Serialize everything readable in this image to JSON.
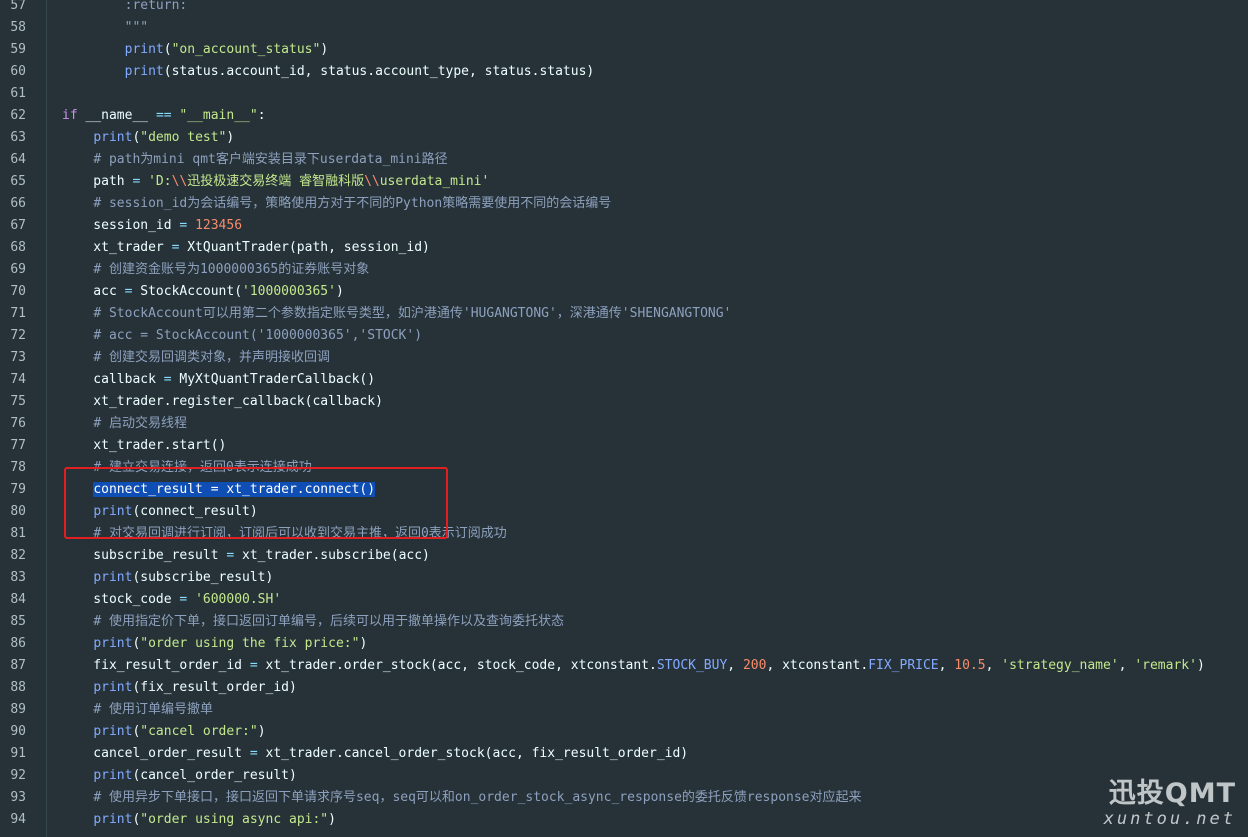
{
  "editor": {
    "colors": {
      "background": "#263238",
      "keyword": "#c792ea",
      "function": "#82aaff",
      "string": "#c3e88d",
      "number": "#f78c6c",
      "comment": "#8da0bd",
      "operator": "#89ddff",
      "selection": "#0f4fb5",
      "annotation_box": "#e02020"
    },
    "highlighted_lines": [
      78,
      80
    ],
    "selected_line": 79,
    "lines": [
      {
        "n": "57",
        "t": [
          [
            "        ",
            ""
          ],
          [
            ":return:",
            "cmt"
          ]
        ]
      },
      {
        "n": "58",
        "t": [
          [
            "        ",
            ""
          ],
          [
            "\"\"\"",
            "cmt"
          ]
        ]
      },
      {
        "n": "59",
        "t": [
          [
            "        ",
            ""
          ],
          [
            "print",
            "fn"
          ],
          [
            "(",
            ""
          ],
          [
            "\"on_account_status\"",
            "str"
          ],
          [
            ")",
            ""
          ]
        ]
      },
      {
        "n": "60",
        "t": [
          [
            "        ",
            ""
          ],
          [
            "print",
            "fn"
          ],
          [
            "(status.account_id, status.account_type, status.status)",
            ""
          ]
        ]
      },
      {
        "n": "61",
        "t": []
      },
      {
        "n": "62",
        "t": [
          [
            "if",
            "kw"
          ],
          [
            " __name__ ",
            ""
          ],
          [
            "==",
            "op"
          ],
          [
            " ",
            ""
          ],
          [
            "\"__main__\"",
            "str"
          ],
          [
            ":",
            ""
          ]
        ]
      },
      {
        "n": "63",
        "t": [
          [
            "    ",
            ""
          ],
          [
            "print",
            "fn"
          ],
          [
            "(",
            ""
          ],
          [
            "\"demo test\"",
            "str"
          ],
          [
            ")",
            ""
          ]
        ]
      },
      {
        "n": "64",
        "t": [
          [
            "    ",
            ""
          ],
          [
            "# path为mini qmt客户端安装目录下userdata_mini路径",
            "cmt"
          ]
        ]
      },
      {
        "n": "65",
        "t": [
          [
            "    path ",
            ""
          ],
          [
            "=",
            "op"
          ],
          [
            " ",
            ""
          ],
          [
            "'D:",
            "str"
          ],
          [
            "\\\\",
            "num"
          ],
          [
            "迅投极速交易终端 睿智融科版",
            "str"
          ],
          [
            "\\\\",
            "num"
          ],
          [
            "userdata_mini'",
            "str"
          ]
        ]
      },
      {
        "n": "66",
        "t": [
          [
            "    ",
            ""
          ],
          [
            "# session_id为会话编号，策略使用方对于不同的Python策略需要使用不同的会话编号",
            "cmt"
          ]
        ]
      },
      {
        "n": "67",
        "t": [
          [
            "    session_id ",
            ""
          ],
          [
            "=",
            "op"
          ],
          [
            " ",
            ""
          ],
          [
            "123456",
            "num"
          ]
        ]
      },
      {
        "n": "68",
        "t": [
          [
            "    xt_trader ",
            ""
          ],
          [
            "=",
            "op"
          ],
          [
            " XtQuantTrader(path, session_id)",
            ""
          ]
        ]
      },
      {
        "n": "69",
        "t": [
          [
            "    ",
            ""
          ],
          [
            "# 创建资金账号为1000000365的证券账号对象",
            "cmt"
          ]
        ]
      },
      {
        "n": "70",
        "t": [
          [
            "    acc ",
            ""
          ],
          [
            "=",
            "op"
          ],
          [
            " StockAccount(",
            ""
          ],
          [
            "'1000000365'",
            "str"
          ],
          [
            ")",
            ""
          ]
        ]
      },
      {
        "n": "71",
        "t": [
          [
            "    ",
            ""
          ],
          [
            "# StockAccount可以用第二个参数指定账号类型，如沪港通传'HUGANGTONG'，深港通传'SHENGANGTONG'",
            "cmt"
          ]
        ]
      },
      {
        "n": "72",
        "t": [
          [
            "    ",
            ""
          ],
          [
            "# acc = StockAccount('1000000365','STOCK')",
            "cmt"
          ]
        ]
      },
      {
        "n": "73",
        "t": [
          [
            "    ",
            ""
          ],
          [
            "# 创建交易回调类对象，并声明接收回调",
            "cmt"
          ]
        ]
      },
      {
        "n": "74",
        "t": [
          [
            "    callback ",
            ""
          ],
          [
            "=",
            "op"
          ],
          [
            " MyXtQuantTraderCallback()",
            ""
          ]
        ]
      },
      {
        "n": "75",
        "t": [
          [
            "    xt_trader.register_callback(callback)",
            ""
          ]
        ]
      },
      {
        "n": "76",
        "t": [
          [
            "    ",
            ""
          ],
          [
            "# 启动交易线程",
            "cmt"
          ]
        ]
      },
      {
        "n": "77",
        "t": [
          [
            "    xt_trader.start()",
            ""
          ]
        ]
      },
      {
        "n": "78",
        "t": [
          [
            "    ",
            ""
          ],
          [
            "# 建立交易连接，返回0表示连接成功",
            "cmt"
          ]
        ]
      },
      {
        "n": "79",
        "t": [
          [
            "    ",
            ""
          ],
          [
            "connect_result = xt_trader.connect()",
            "sel"
          ]
        ]
      },
      {
        "n": "80",
        "t": [
          [
            "    ",
            ""
          ],
          [
            "print",
            "fn"
          ],
          [
            "(connect_result)",
            ""
          ]
        ]
      },
      {
        "n": "81",
        "t": [
          [
            "    ",
            ""
          ],
          [
            "# 对交易回调进行订阅，订阅后可以收到交易主推，返回0表示订阅成功",
            "cmt"
          ]
        ]
      },
      {
        "n": "82",
        "t": [
          [
            "    subscribe_result ",
            ""
          ],
          [
            "=",
            "op"
          ],
          [
            " xt_trader.subscribe(acc)",
            ""
          ]
        ]
      },
      {
        "n": "83",
        "t": [
          [
            "    ",
            ""
          ],
          [
            "print",
            "fn"
          ],
          [
            "(subscribe_result)",
            ""
          ]
        ]
      },
      {
        "n": "84",
        "t": [
          [
            "    stock_code ",
            ""
          ],
          [
            "=",
            "op"
          ],
          [
            " ",
            ""
          ],
          [
            "'600000.SH'",
            "str"
          ]
        ]
      },
      {
        "n": "85",
        "t": [
          [
            "    ",
            ""
          ],
          [
            "# 使用指定价下单，接口返回订单编号，后续可以用于撤单操作以及查询委托状态",
            "cmt"
          ]
        ]
      },
      {
        "n": "86",
        "t": [
          [
            "    ",
            ""
          ],
          [
            "print",
            "fn"
          ],
          [
            "(",
            ""
          ],
          [
            "\"order using the fix price:\"",
            "str"
          ],
          [
            ")",
            ""
          ]
        ]
      },
      {
        "n": "87",
        "t": [
          [
            "    fix_result_order_id ",
            ""
          ],
          [
            "=",
            "op"
          ],
          [
            " xt_trader.order_stock(acc, stock_code, xtconstant.",
            ""
          ],
          [
            "STOCK_BUY",
            "const"
          ],
          [
            ", ",
            ""
          ],
          [
            "200",
            "num"
          ],
          [
            ", xtconstant.",
            ""
          ],
          [
            "FIX_PRICE",
            "const"
          ],
          [
            ", ",
            ""
          ],
          [
            "10.5",
            "num"
          ],
          [
            ", ",
            ""
          ],
          [
            "'strategy_name'",
            "str"
          ],
          [
            ", ",
            ""
          ],
          [
            "'remark'",
            "str"
          ],
          [
            ")",
            ""
          ]
        ]
      },
      {
        "n": "88",
        "t": [
          [
            "    ",
            ""
          ],
          [
            "print",
            "fn"
          ],
          [
            "(fix_result_order_id)",
            ""
          ]
        ]
      },
      {
        "n": "89",
        "t": [
          [
            "    ",
            ""
          ],
          [
            "# 使用订单编号撤单",
            "cmt"
          ]
        ]
      },
      {
        "n": "90",
        "t": [
          [
            "    ",
            ""
          ],
          [
            "print",
            "fn"
          ],
          [
            "(",
            ""
          ],
          [
            "\"cancel order:\"",
            "str"
          ],
          [
            ")",
            ""
          ]
        ]
      },
      {
        "n": "91",
        "t": [
          [
            "    cancel_order_result ",
            ""
          ],
          [
            "=",
            "op"
          ],
          [
            " xt_trader.cancel_order_stock(acc, fix_result_order_id)",
            ""
          ]
        ]
      },
      {
        "n": "92",
        "t": [
          [
            "    ",
            ""
          ],
          [
            "print",
            "fn"
          ],
          [
            "(cancel_order_result)",
            ""
          ]
        ]
      },
      {
        "n": "93",
        "t": [
          [
            "    ",
            ""
          ],
          [
            "# 使用异步下单接口，接口返回下单请求序号seq，seq可以和on_order_stock_async_response的委托反馈response对应起来",
            "cmt"
          ]
        ]
      },
      {
        "n": "94",
        "t": [
          [
            "    ",
            ""
          ],
          [
            "print",
            "fn"
          ],
          [
            "(",
            ""
          ],
          [
            "\"order using async api:\"",
            "str"
          ],
          [
            ")",
            ""
          ]
        ]
      }
    ]
  },
  "watermark": {
    "brand": "迅投QMT",
    "url": "xuntou.net"
  }
}
